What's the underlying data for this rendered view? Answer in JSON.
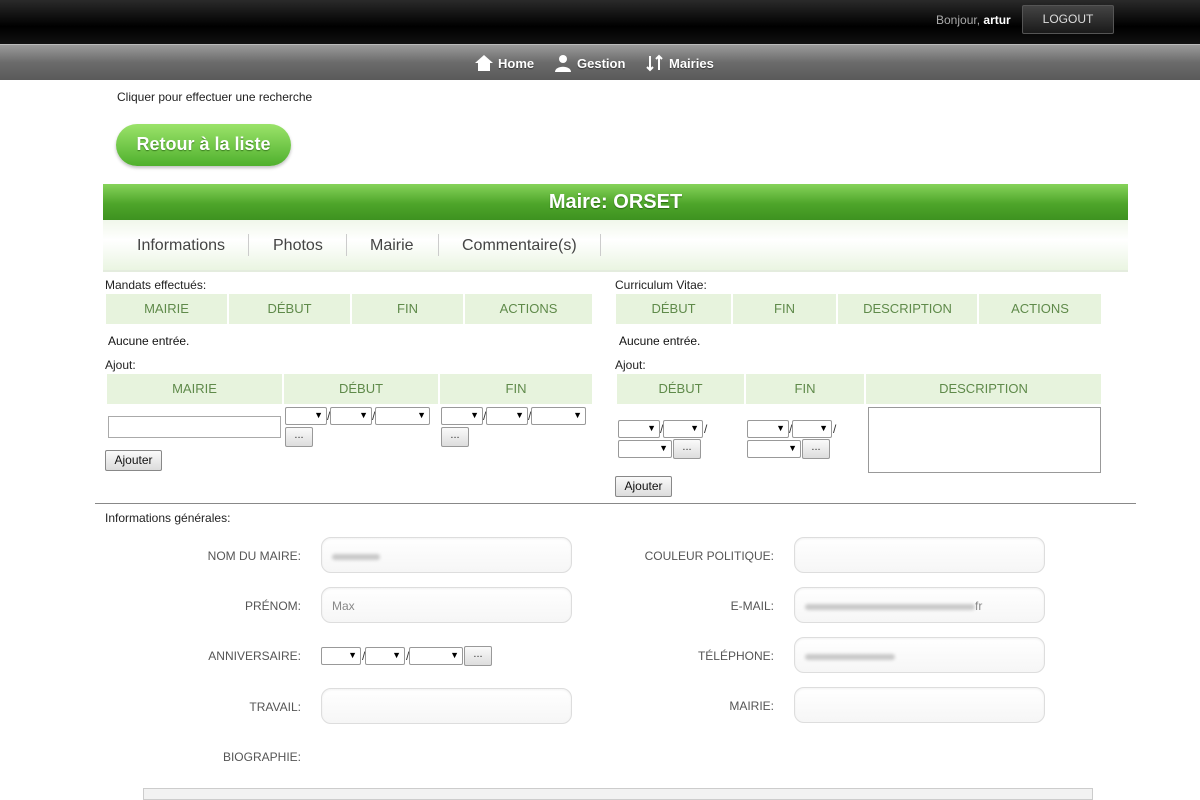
{
  "topbar": {
    "greeting_prefix": "Bonjour,",
    "username": "artur",
    "logout_label": "LOGOUT"
  },
  "nav": {
    "items": [
      {
        "label": "Home",
        "icon": "home-icon"
      },
      {
        "label": "Gestion",
        "icon": "user-icon"
      },
      {
        "label": "Mairies",
        "icon": "sort-arrows-icon"
      }
    ]
  },
  "search_hint": "Cliquer pour effectuer une recherche",
  "back_button": "Retour à la liste",
  "title": "Maire: ORSET",
  "tabs": [
    "Informations",
    "Photos",
    "Mairie",
    "Commentaire(s)"
  ],
  "mandats": {
    "label": "Mandats effectués:",
    "headers": [
      "MAIRIE",
      "DÉBUT",
      "FIN",
      "ACTIONS"
    ],
    "empty": "Aucune entrée.",
    "add_label": "Ajout:",
    "add_headers": [
      "MAIRIE",
      "DÉBUT",
      "FIN"
    ],
    "add_button": "Ajouter"
  },
  "cv": {
    "label": "Curriculum Vitae:",
    "headers": [
      "DÉBUT",
      "FIN",
      "DESCRIPTION",
      "ACTIONS"
    ],
    "empty": "Aucune entrée.",
    "add_label": "Ajout:",
    "add_headers": [
      "DÉBUT",
      "FIN",
      "DESCRIPTION"
    ],
    "add_button": "Ajouter"
  },
  "general": {
    "label": "Informations générales:",
    "fields": {
      "nom": {
        "label": "NOM DU MAIRE:",
        "value": ""
      },
      "prenom": {
        "label": "PRÉNOM:",
        "value": "Max"
      },
      "anniversaire": {
        "label": "ANNIVERSAIRE:"
      },
      "travail": {
        "label": "TRAVAIL:",
        "value": ""
      },
      "biographie": {
        "label": "BIOGRAPHIE:"
      },
      "couleur": {
        "label": "COULEUR POLITIQUE:",
        "value": ""
      },
      "email": {
        "label": "E-MAIL:",
        "value_suffix": "fr"
      },
      "telephone": {
        "label": "TÉLÉPHONE:",
        "value": ""
      },
      "mairie": {
        "label": "MAIRIE:",
        "value": ""
      }
    }
  },
  "misc": {
    "dots": "...",
    "slash": "/"
  }
}
